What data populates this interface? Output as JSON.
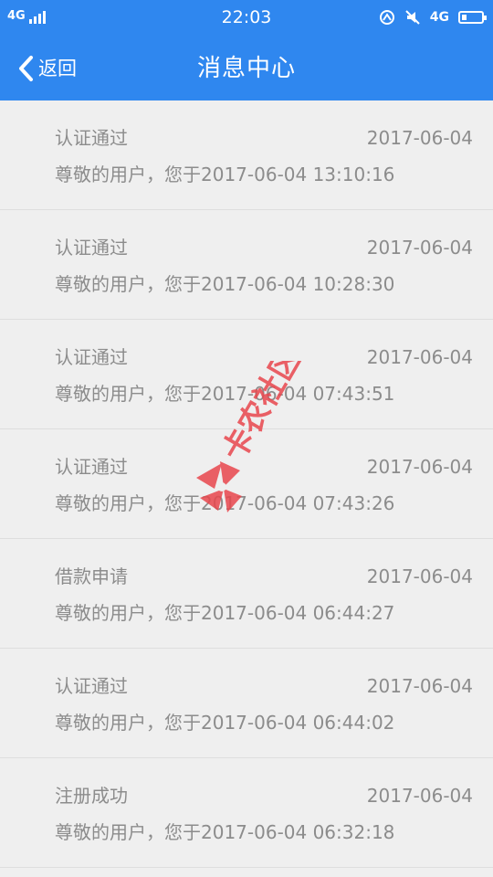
{
  "status_bar": {
    "network_left": "4G",
    "time": "22:03",
    "network_right": "4G",
    "icons": [
      "signal-icon",
      "nfc-icon",
      "mute-icon",
      "battery-icon"
    ]
  },
  "navbar": {
    "back_label": "返回",
    "title": "消息中心",
    "background_color": "#2f87ef"
  },
  "messages": [
    {
      "title": "认证通过",
      "date": "2017-06-04",
      "body": "尊敬的用户，您于2017-06-04 13:10:16"
    },
    {
      "title": "认证通过",
      "date": "2017-06-04",
      "body": "尊敬的用户，您于2017-06-04 10:28:30"
    },
    {
      "title": "认证通过",
      "date": "2017-06-04",
      "body": "尊敬的用户，您于2017-06-04 07:43:51"
    },
    {
      "title": "认证通过",
      "date": "2017-06-04",
      "body": "尊敬的用户，您于2017-06-04 07:43:26"
    },
    {
      "title": "借款申请",
      "date": "2017-06-04",
      "body": "尊敬的用户，您于2017-06-04 06:44:27"
    },
    {
      "title": "认证通过",
      "date": "2017-06-04",
      "body": "尊敬的用户，您于2017-06-04 06:44:02"
    },
    {
      "title": "注册成功",
      "date": "2017-06-04",
      "body": "尊敬的用户，您于2017-06-04 06:32:18"
    }
  ],
  "watermark": {
    "text": "卡农社区",
    "color": "#e8474d"
  }
}
